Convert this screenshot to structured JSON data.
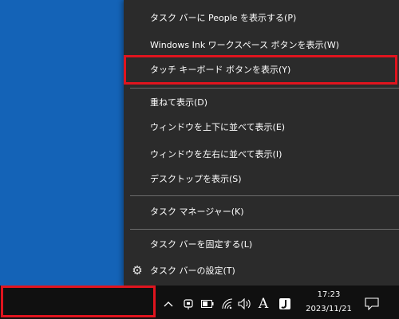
{
  "context_menu": {
    "items": [
      {
        "label": "タスク バーに People を表示する(P)"
      },
      {
        "label": "Windows Ink ワークスペース ボタンを表示(W)"
      },
      {
        "label": "タッチ キーボード ボタンを表示(Y)"
      },
      {
        "label": "重ねて表示(D)"
      },
      {
        "label": "ウィンドウを上下に並べて表示(E)"
      },
      {
        "label": "ウィンドウを左右に並べて表示(I)"
      },
      {
        "label": "デスクトップを表示(S)"
      },
      {
        "label": "タスク マネージャー(K)"
      },
      {
        "label": "タスク バーを固定する(L)"
      },
      {
        "label": "タスク バーの設定(T)",
        "icon": "gear-icon"
      }
    ]
  },
  "taskbar": {
    "tray_icons": [
      "chevron-up-icon",
      "touch-keyboard-icon",
      "battery-icon",
      "wifi-icon",
      "volume-icon",
      "ime-mode-icon",
      "ime-icon"
    ],
    "ime_mode": "A",
    "clock": {
      "time": "17:23",
      "date": "2023/11/21"
    },
    "notification_icon": "action-center-icon"
  },
  "highlight_color": "#e0141e"
}
